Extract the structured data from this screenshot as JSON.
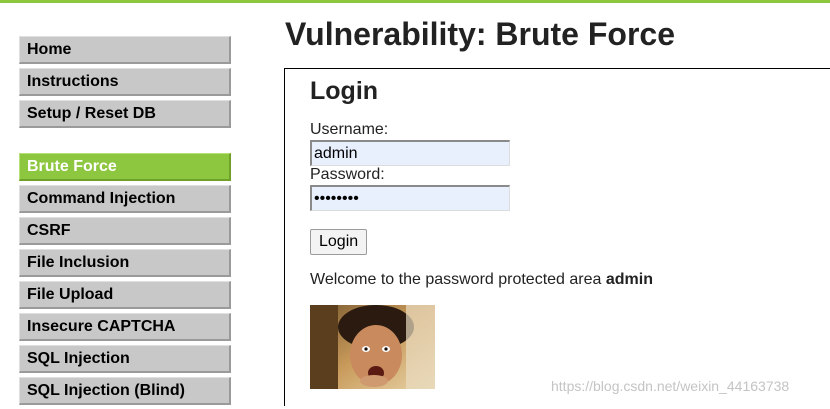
{
  "page_title": "Vulnerability: Brute Force",
  "menu": {
    "group1": [
      "Home",
      "Instructions",
      "Setup / Reset DB"
    ],
    "group2": [
      "Brute Force",
      "Command Injection",
      "CSRF",
      "File Inclusion",
      "File Upload",
      "Insecure CAPTCHA",
      "SQL Injection",
      "SQL Injection (Blind)"
    ],
    "selected": "Brute Force"
  },
  "login": {
    "heading": "Login",
    "username_label": "Username:",
    "username_value": "admin",
    "password_label": "Password:",
    "password_value": "••••••••",
    "button_label": "Login"
  },
  "result": {
    "welcome_prefix": "Welcome to the password protected area",
    "welcome_user": "admin"
  },
  "watermark": "https://blog.csdn.net/weixin_44163738",
  "colors": {
    "accent": "#8dc63f",
    "menu_bg": "#c8c8c8"
  }
}
